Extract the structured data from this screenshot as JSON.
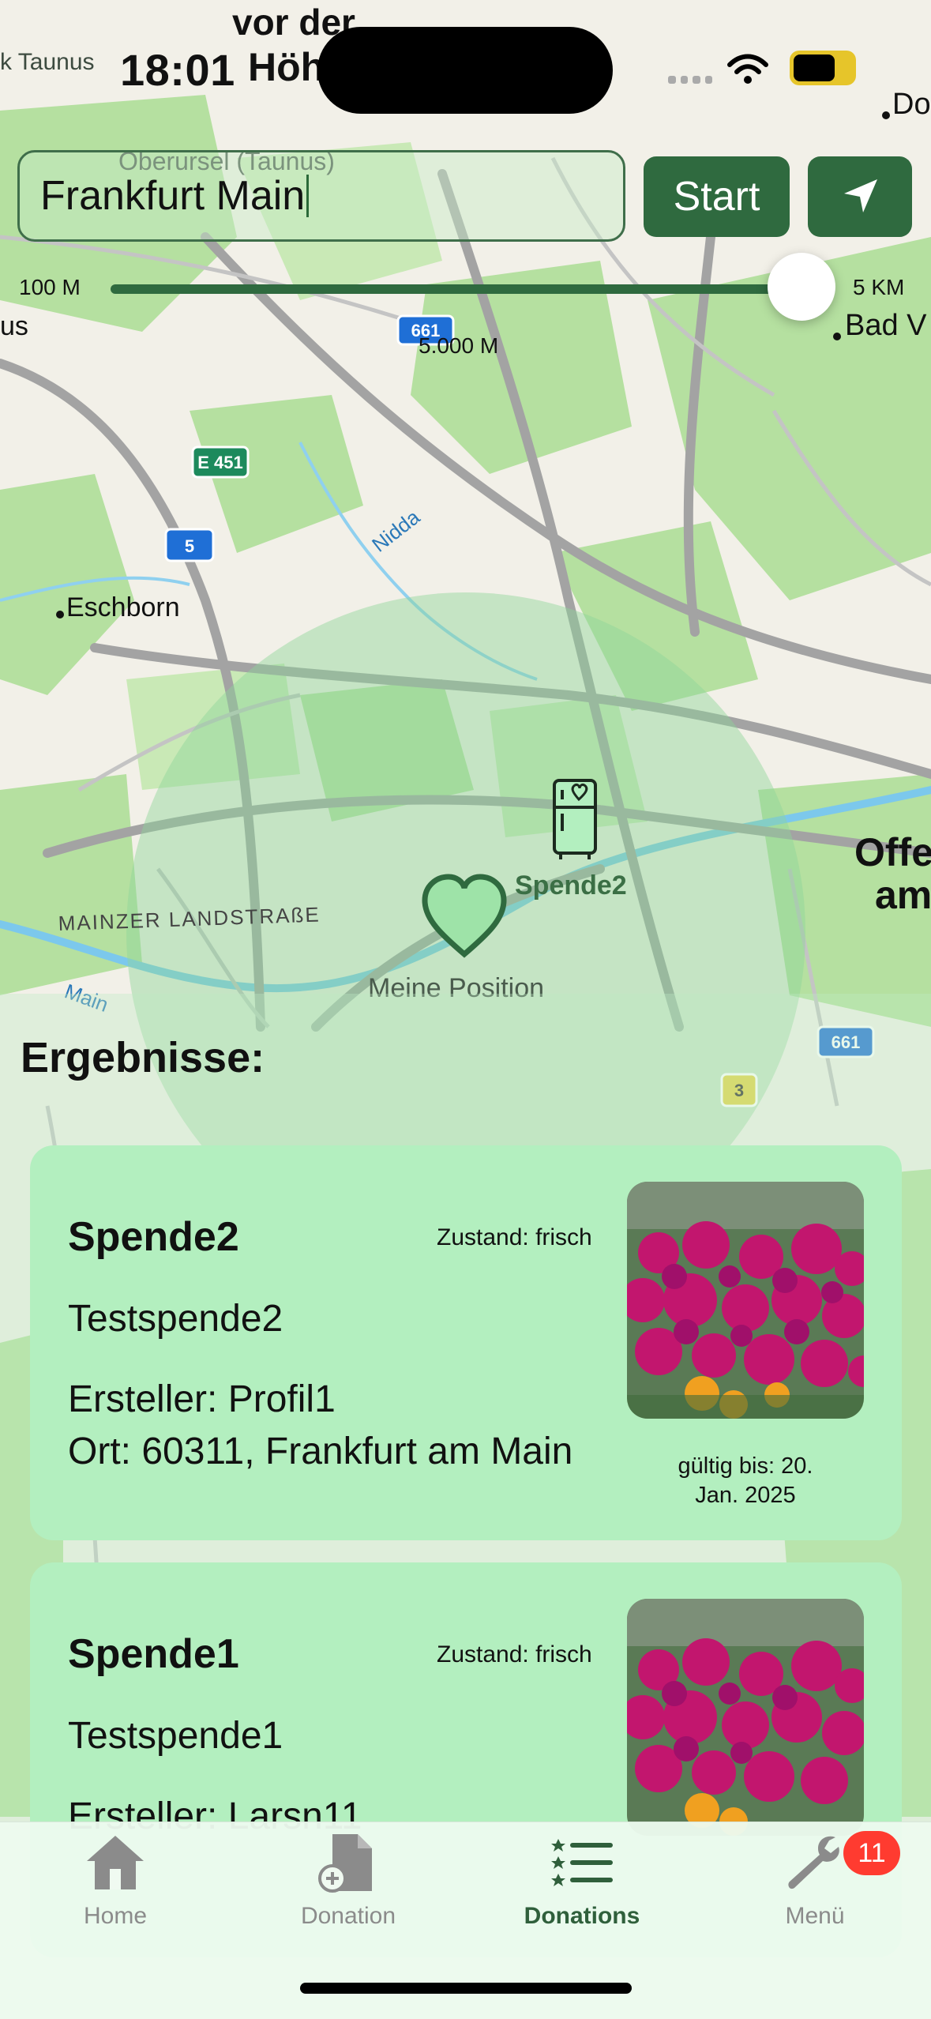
{
  "status_bar": {
    "time": "18:01"
  },
  "map": {
    "place_labels": [
      {
        "name": "vor der",
        "id": "vor-der"
      },
      {
        "name": "Höh",
        "id": "hoeh"
      },
      {
        "name": "k Taunus",
        "id": "taunus-left"
      },
      {
        "name": "Oberursel (Taunus)",
        "id": "oberursel"
      },
      {
        "name": "Eschborn",
        "id": "eschborn"
      },
      {
        "name": "Bad V",
        "id": "bad-v"
      },
      {
        "name": "Do",
        "id": "do"
      },
      {
        "name": "us",
        "id": "us"
      },
      {
        "name": "Offe",
        "id": "offe"
      },
      {
        "name": "am",
        "id": "am"
      },
      {
        "name": "MAINZER LANDSTRAßE",
        "id": "mainzer"
      },
      {
        "name": "Main",
        "id": "main-river"
      },
      {
        "name": "Nidda",
        "id": "nidda"
      }
    ],
    "road_shields": [
      "661",
      "E 451",
      "5",
      "661",
      "3"
    ],
    "pins": {
      "donation_label": "Spende2",
      "my_position_label": "Meine Position"
    },
    "colors": {
      "land": "#f2f0e8",
      "green": "#a9dc94",
      "road": "#9e9e9e",
      "water": "#7cc8ec",
      "radius": "#8fd59a"
    }
  },
  "search": {
    "value": "Frankfurt Main"
  },
  "buttons": {
    "start": "Start"
  },
  "radius_slider": {
    "min_label": "100 M",
    "max_label": "5 KM",
    "current_label": "5.000 M",
    "fraction": 1.0
  },
  "results": {
    "title": "Ergebnisse:",
    "cards": [
      {
        "title": "Spende2",
        "condition": "Zustand: frisch",
        "description": "Testspende2",
        "creator": "Ersteller: Profil1",
        "place": "Ort: 60311, Frankfurt am Main",
        "valid_line1": "gültig bis: 20.",
        "valid_line2": "Jan. 2025"
      },
      {
        "title": "Spende1",
        "condition": "Zustand: frisch",
        "description": "Testspende1",
        "creator": "Ersteller: Larsn11"
      }
    ]
  },
  "tabbar": {
    "tabs": [
      {
        "label": "Home",
        "icon": "house-icon"
      },
      {
        "label": "Donation",
        "icon": "document-add-icon"
      },
      {
        "label": "Donations",
        "icon": "list-icon",
        "active": true
      },
      {
        "label": "Menü",
        "icon": "wrench-icon"
      }
    ],
    "menu_badge": "11"
  },
  "accent_color": "#2f6a3f"
}
